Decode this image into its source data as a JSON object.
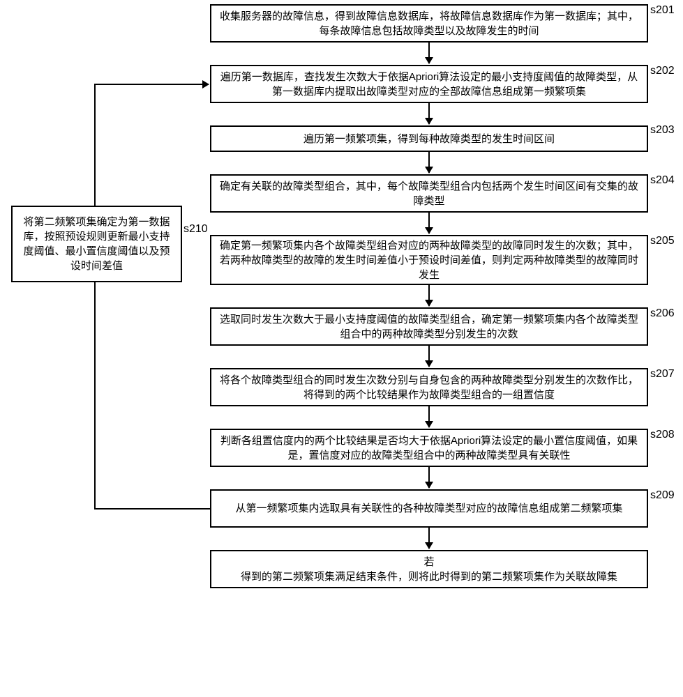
{
  "steps": {
    "s201": {
      "label": "s201",
      "text": "收集服务器的故障信息，得到故障信息数据库，将故障信息数据库作为第一数据库；其中，每条故障信息包括故障类型以及故障发生的时间"
    },
    "s202": {
      "label": "s202",
      "text": "遍历第一数据库，查找发生次数大于依据Apriori算法设定的最小支持度阈值的故障类型，从第一数据库内提取出故障类型对应的全部故障信息组成第一频繁项集"
    },
    "s203": {
      "label": "s203",
      "text": "遍历第一频繁项集，得到每种故障类型的发生时间区间"
    },
    "s204": {
      "label": "s204",
      "text": "确定有关联的故障类型组合，其中，每个故障类型组合内包括两个发生时间区间有交集的故障类型"
    },
    "s205": {
      "label": "s205",
      "text": "确定第一频繁项集内各个故障类型组合对应的两种故障类型的故障同时发生的次数；其中，若两种故障类型的故障的发生时间差值小于预设时间差值，则判定两种故障类型的故障同时发生"
    },
    "s206": {
      "label": "s206",
      "text": "选取同时发生次数大于最小支持度阈值的故障类型组合，确定第一频繁项集内各个故障类型组合中的两种故障类型分别发生的次数"
    },
    "s207": {
      "label": "s207",
      "text": "将各个故障类型组合的同时发生次数分别与自身包含的两种故障类型分别发生的次数作比，将得到的两个比较结果作为故障类型组合的一组置信度"
    },
    "s208": {
      "label": "s208",
      "text": "判断各组置信度内的两个比较结果是否均大于依据Apriori算法设定的最小置信度阈值，如果是，置信度对应的故障类型组合中的两种故障类型具有关联性"
    },
    "s209": {
      "label": "s209",
      "text": "从第一频繁项集内选取具有关联性的各种故障类型对应的故障信息组成第二频繁项集"
    },
    "s210": {
      "label": "s210",
      "text": "将第二频繁项集确定为第一数据库，按照预设规则更新最小支持度阈值、最小置信度阈值以及预设时间差值"
    },
    "final_if": "若",
    "final": "得到的第二频繁项集满足结束条件，则将此时得到的第二频繁项集作为关联故障集"
  }
}
